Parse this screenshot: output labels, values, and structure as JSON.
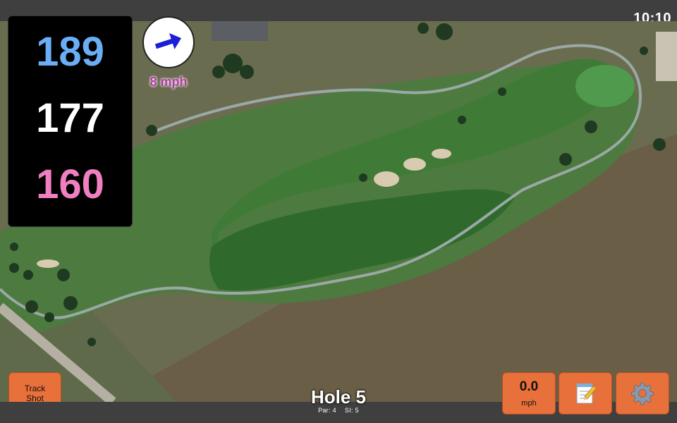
{
  "status": {
    "time": "10:10"
  },
  "distances": {
    "back": {
      "value": "189",
      "color": "#6aaef5"
    },
    "middle": {
      "value": "177",
      "color": "#ffffff"
    },
    "front": {
      "value": "160",
      "color": "#f27ec2"
    }
  },
  "wind": {
    "speed_label": "8 mph",
    "arrow_icon": "arrow-right-icon",
    "arrow_color": "#1b1fd6"
  },
  "buttons": {
    "track_shot": {
      "line1": "Track",
      "line2": "Shot"
    },
    "speed": {
      "value": "0.0",
      "unit": "mph"
    },
    "notes_icon": "notepad-icon",
    "settings_icon": "gear-icon"
  },
  "hole": {
    "title": "Hole 5",
    "par_label": "Par: 4",
    "si_label": "SI: 5"
  },
  "colors": {
    "accent": "#e8703a"
  }
}
